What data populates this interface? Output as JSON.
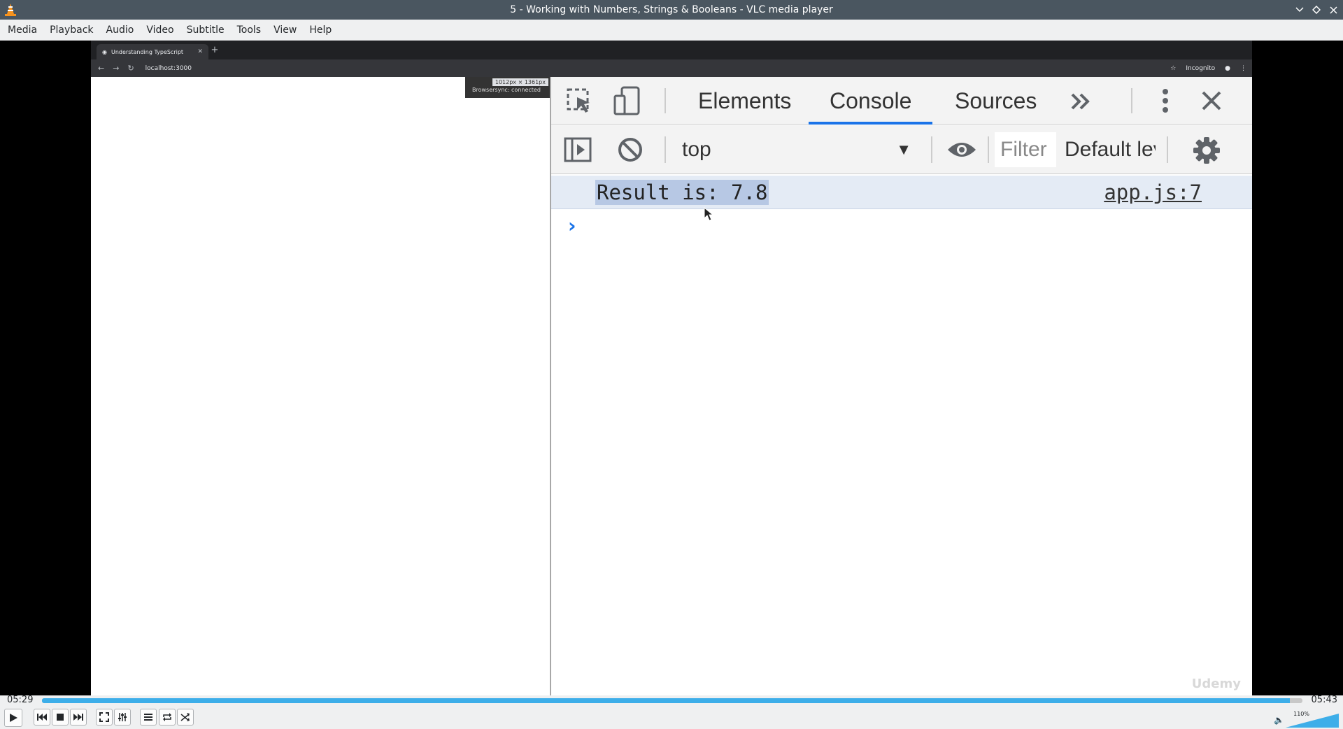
{
  "window": {
    "title": "5 - Working with Numbers, Strings & Booleans - VLC media player"
  },
  "menu": [
    "Media",
    "Playback",
    "Audio",
    "Video",
    "Subtitle",
    "Tools",
    "View",
    "Help"
  ],
  "video": {
    "browser": {
      "tab_title": "Understanding TypeScript",
      "url": "localhost:3000",
      "incognito_label": "Incognito",
      "size_tooltip": "1012px × 1361px",
      "size_hint": "Browsersync: connected"
    },
    "devtools": {
      "tabs": [
        "Elements",
        "Console",
        "Sources"
      ],
      "active_tab": "Console",
      "context": "top",
      "filter_placeholder": "Filter",
      "levels_label": "Default levels",
      "log_message": "Result is: 7.8",
      "log_source": "app.js:7",
      "watermark": "Udemy"
    }
  },
  "player": {
    "elapsed": "05:29",
    "total": "05:43",
    "progress_percent": 99,
    "volume_label": "110%",
    "volume_percent": 100,
    "accent_color": "#3daee9"
  }
}
